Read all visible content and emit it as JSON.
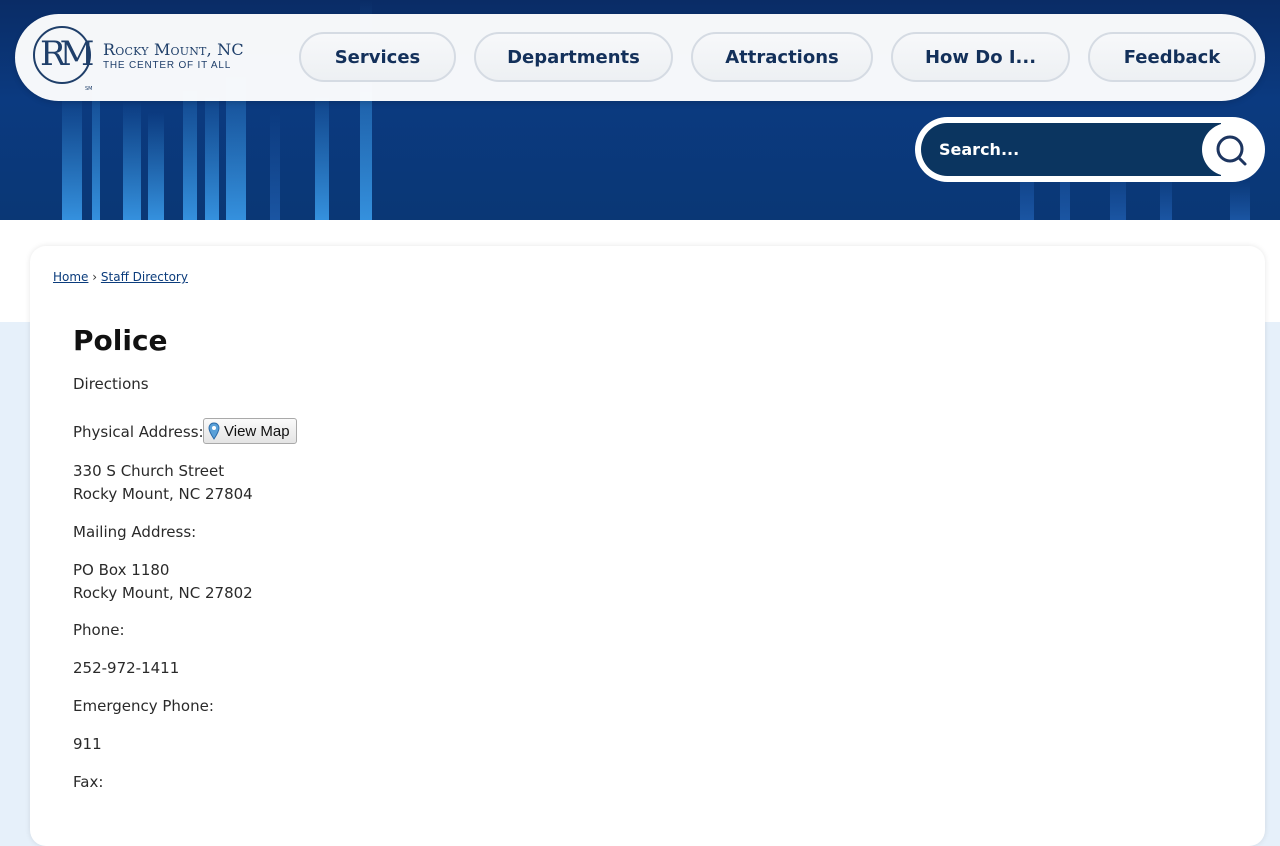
{
  "site": {
    "logo_mono": "RM",
    "logo_sm": "SM",
    "name": "Rocky Mount, NC",
    "tagline": "THE CENTER OF IT ALL"
  },
  "nav": {
    "items": [
      {
        "label": "Services"
      },
      {
        "label": "Departments"
      },
      {
        "label": "Attractions"
      },
      {
        "label": "How Do I..."
      },
      {
        "label": "Feedback"
      }
    ]
  },
  "search": {
    "placeholder": "Search...",
    "icon": "search-icon"
  },
  "breadcrumb": {
    "home": "Home",
    "separator": "›",
    "current": "Staff Directory"
  },
  "page": {
    "title": "Police",
    "directions_link": "Directions",
    "physical_label": "Physical Address:",
    "view_map": "View Map",
    "physical_line1": "330 S Church Street",
    "physical_line2": "Rocky Mount, NC 27804",
    "mailing_label": "Mailing Address:",
    "mailing_line1": "PO Box 1180",
    "mailing_line2": "Rocky Mount, NC 27802",
    "phone_label": "Phone:",
    "phone": "252-972-1411",
    "emergency_label": "Emergency Phone:",
    "emergency": "911",
    "fax_label": "Fax:"
  },
  "colors": {
    "nav_text": "#13305a",
    "search_bg": "#0b3560",
    "link": "#2a83b6"
  }
}
